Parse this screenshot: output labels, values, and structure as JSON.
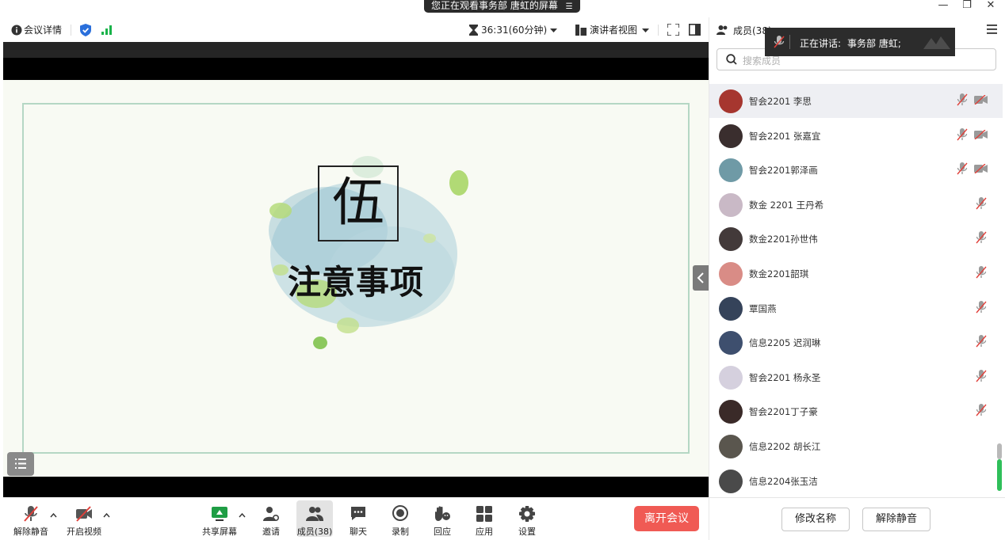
{
  "window": {
    "watching_banner": "您正在观看事务部 唐虹的屏幕",
    "banner_menu_glyph": "☰",
    "minimize_glyph": "—",
    "restore_glyph": "❐",
    "close_glyph": "✕"
  },
  "topbar": {
    "meeting_info": "会议详情",
    "timer": "36:31(60分钟)",
    "view_mode": "演讲者视图"
  },
  "slide": {
    "char": "伍",
    "title": "注意事项"
  },
  "toolbar": {
    "unmute": "解除静音",
    "start_video": "开启视频",
    "share_screen": "共享屏幕",
    "invite": "邀请",
    "members": "成员(38)",
    "chat": "聊天",
    "record": "录制",
    "reactions": "回应",
    "apps": "应用",
    "settings": "设置",
    "leave": "离开会议"
  },
  "panel": {
    "tab_members": "成员(38)",
    "speaking_label": "正在讲话:",
    "speaking_name": "事务部 唐虹;",
    "search_placeholder": "搜索成员",
    "members": [
      {
        "name": "智会2201 李思",
        "muted": true,
        "video_off": true,
        "color": "#a6362f"
      },
      {
        "name": "智会2201 张嘉宜",
        "muted": true,
        "video_off": true,
        "color": "#3a2e2e"
      },
      {
        "name": "智会2201郭泽画",
        "muted": true,
        "video_off": true,
        "color": "#6f9aa6"
      },
      {
        "name": "数金 2201 王丹希",
        "muted": true,
        "video_off": false,
        "color": "#c9b9c6"
      },
      {
        "name": "数金2201孙世伟",
        "muted": true,
        "video_off": false,
        "color": "#433a3a"
      },
      {
        "name": "数金2201韶琪",
        "muted": true,
        "video_off": false,
        "color": "#d98c86"
      },
      {
        "name": "覃国燕",
        "muted": true,
        "video_off": false,
        "color": "#35435a"
      },
      {
        "name": "信息2205 迟润琳",
        "muted": true,
        "video_off": false,
        "color": "#3e4f6e"
      },
      {
        "name": "智会2201 杨永圣",
        "muted": true,
        "video_off": false,
        "color": "#d5d0de"
      },
      {
        "name": "智会2201丁子豪",
        "muted": true,
        "video_off": false,
        "color": "#3a2a28"
      },
      {
        "name": "信息2202 胡长江",
        "muted": false,
        "video_off": false,
        "color": "#5a564e"
      },
      {
        "name": "信息2204张玉洁",
        "muted": false,
        "video_off": false,
        "color": "#4a4a4a"
      }
    ],
    "rename_button": "修改名称",
    "unmute_button": "解除静音"
  },
  "colors": {
    "accent_blue": "#2a6fdb",
    "signal_green": "#19b34a",
    "leave_red": "#f05a54",
    "speaker_bar_green": "#2fbf5a"
  }
}
